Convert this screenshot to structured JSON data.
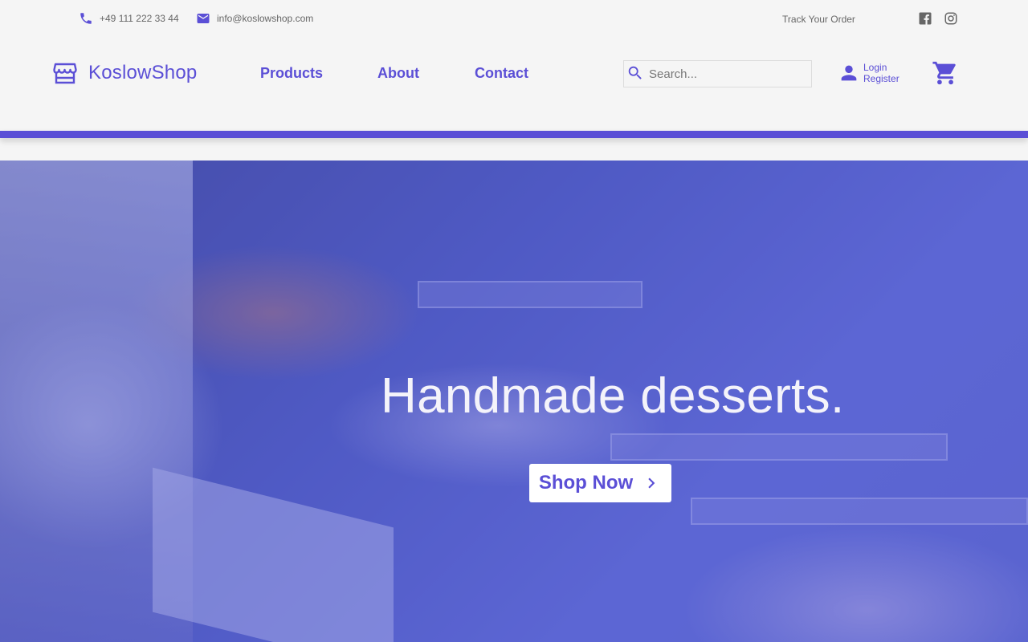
{
  "topbar": {
    "phone": "+49 111 222 33 44",
    "email": "info@koslowshop.com",
    "track_order": "Track Your Order",
    "social_icons": [
      "facebook-icon",
      "instagram-icon"
    ]
  },
  "brand": {
    "name_part1": "Koslow",
    "name_part2": "Shop",
    "accent_color": "#5b4fd6"
  },
  "nav": {
    "links": [
      "Products",
      "About",
      "Contact"
    ]
  },
  "search": {
    "placeholder": "Search..."
  },
  "account": {
    "login": "Login",
    "register": "Register"
  },
  "hero": {
    "title": "Handmade desserts.",
    "button_label": "Shop Now"
  }
}
